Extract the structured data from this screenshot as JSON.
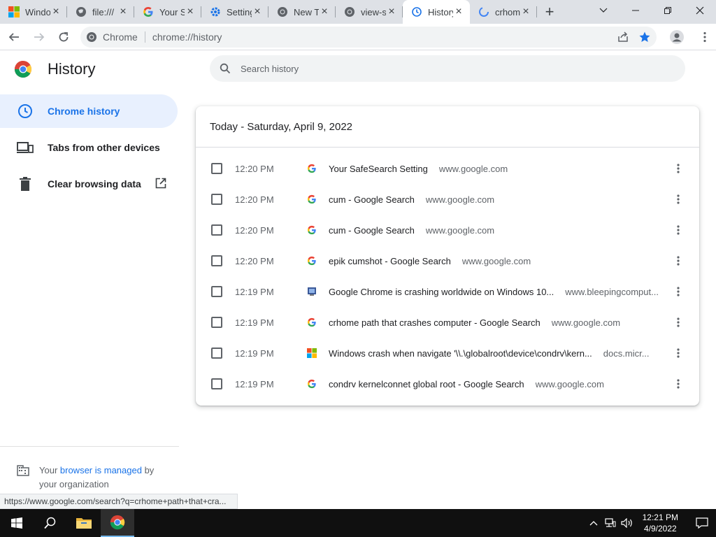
{
  "tabs": [
    {
      "title": "Windows",
      "favicon": "windows-logo-icon"
    },
    {
      "title": "file:///",
      "favicon": "globe-icon"
    },
    {
      "title": "Your SafeSearch",
      "favicon": "google-g-icon"
    },
    {
      "title": "Settings",
      "favicon": "gear-icon"
    },
    {
      "title": "New Tab",
      "favicon": "chrome-icon"
    },
    {
      "title": "view-source",
      "favicon": "chrome-icon"
    },
    {
      "title": "History",
      "favicon": "history-icon",
      "active": true
    },
    {
      "title": "crhome",
      "favicon": "google-g-icon"
    }
  ],
  "toolbar": {
    "site_label": "Chrome",
    "url": "chrome://history"
  },
  "page": {
    "title": "History",
    "search_placeholder": "Search history"
  },
  "sidebar": {
    "items": [
      {
        "label": "Chrome history",
        "icon": "clock-icon",
        "selected": true
      },
      {
        "label": "Tabs from other devices",
        "icon": "devices-icon"
      },
      {
        "label": "Clear browsing data",
        "icon": "trash-icon"
      }
    ],
    "managed_prefix": "Your ",
    "managed_link": "browser is managed",
    "managed_suffix": " by",
    "managed_line2": "your organization"
  },
  "history": {
    "date_header": "Today - Saturday, April 9, 2022",
    "entries": [
      {
        "time": "12:20 PM",
        "title": "Your SafeSearch Setting",
        "domain": "www.google.com",
        "favicon": "google-g-icon"
      },
      {
        "time": "12:20 PM",
        "title": "cum - Google Search",
        "domain": "www.google.com",
        "favicon": "google-g-icon"
      },
      {
        "time": "12:20 PM",
        "title": "cum - Google Search",
        "domain": "www.google.com",
        "favicon": "google-g-icon"
      },
      {
        "time": "12:20 PM",
        "title": "epik cumshot - Google Search",
        "domain": "www.google.com",
        "favicon": "google-g-icon"
      },
      {
        "time": "12:19 PM",
        "title": "Google Chrome is crashing worldwide on Windows 10...",
        "domain": "www.bleepingcomput...",
        "favicon": "bleepingcomputer-icon"
      },
      {
        "time": "12:19 PM",
        "title": "crhome path that crashes computer - Google Search",
        "domain": "www.google.com",
        "favicon": "google-g-icon"
      },
      {
        "time": "12:19 PM",
        "title": "Windows crash when navigate '\\\\.\\globalroot\\device\\condrv\\kern...",
        "domain": "docs.micr...",
        "favicon": "microsoft-logo-icon"
      },
      {
        "time": "12:19 PM",
        "title": "condrv kernelconnet global root - Google Search",
        "domain": "www.google.com",
        "favicon": "google-g-icon"
      }
    ]
  },
  "statusbar": {
    "text": "https://www.google.com/search?q=crhome+path+that+cra..."
  },
  "taskbar": {
    "time": "12:21 PM",
    "date": "4/9/2022"
  },
  "colors": {
    "accent": "#1a73e8",
    "selected_bg": "#e8f0fe",
    "tabstrip_bg": "#dee1e6"
  }
}
